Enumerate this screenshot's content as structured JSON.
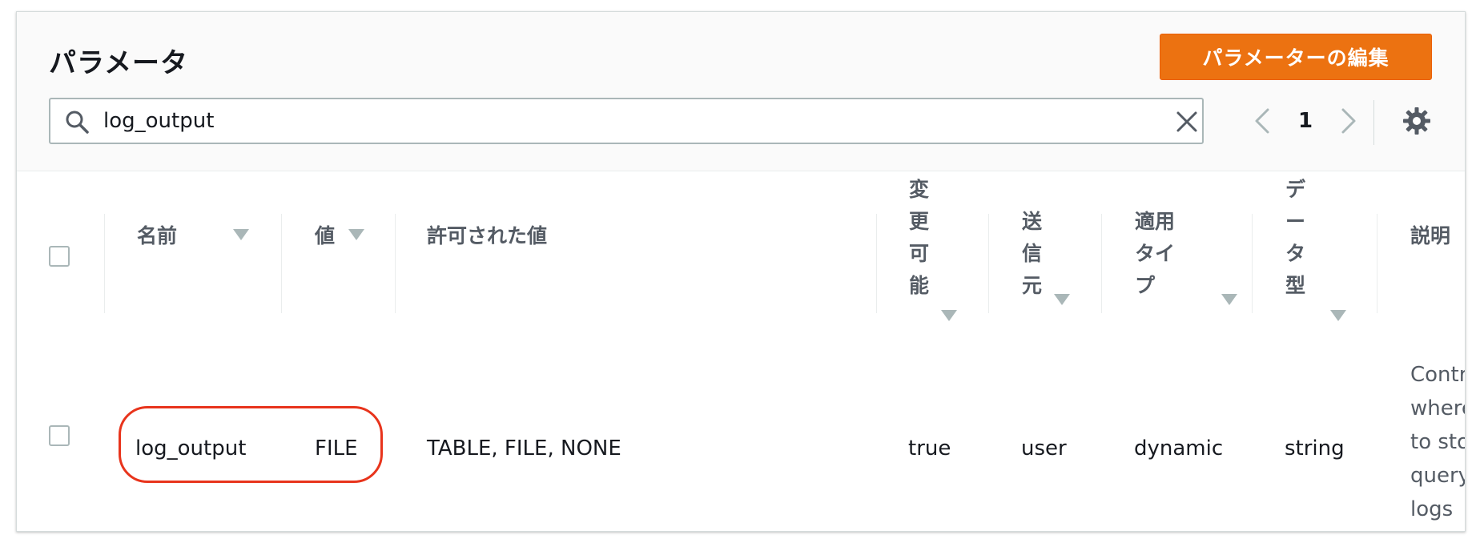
{
  "title": "パラメータ",
  "edit_button_label": "パラメーターの編集",
  "search": {
    "value": "log_output"
  },
  "pagination": {
    "current_page": "1"
  },
  "columns": {
    "name": "名前",
    "value": "値",
    "allowed": "許可された値",
    "modifiable": [
      "変",
      "更",
      "可",
      "能"
    ],
    "source": [
      "送",
      "信",
      "元"
    ],
    "apply_type": [
      "適用",
      "タイ",
      "プ"
    ],
    "data_type": [
      "デ",
      "ー",
      "タ",
      "型"
    ],
    "description": "説明"
  },
  "rows": [
    {
      "name": "log_output",
      "value": "FILE",
      "allowed": "TABLE, FILE, NONE",
      "modifiable": "true",
      "source": "user",
      "apply_type": "dynamic",
      "data_type": "string",
      "description_lines": [
        "Contr",
        "where",
        "to sto",
        "query",
        "logs"
      ]
    }
  ],
  "colors": {
    "accent": "#ec7211",
    "highlight": "#e8341c",
    "header_bg": "#fafafa",
    "muted_text": "#545b64"
  }
}
